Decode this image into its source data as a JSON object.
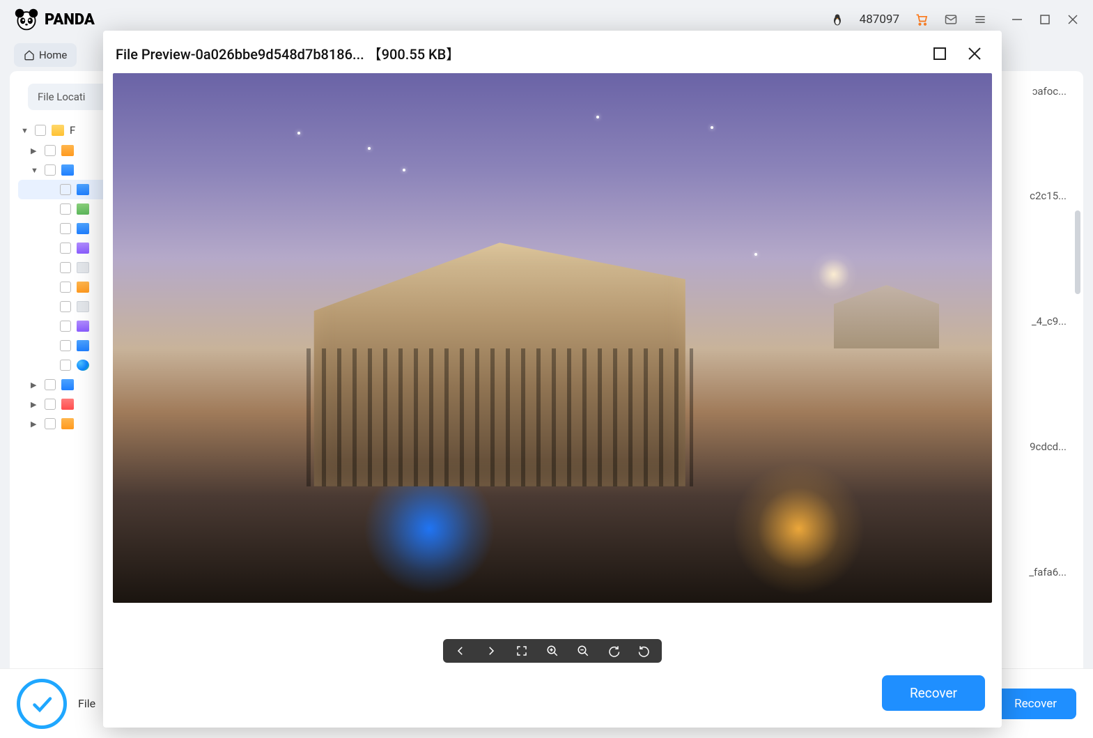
{
  "app": {
    "brand": "PANDA"
  },
  "header": {
    "number": "487097",
    "icons": [
      "penguin-icon",
      "cart-icon",
      "mail-icon",
      "menu-icon"
    ]
  },
  "breadcrumb": {
    "home": "Home"
  },
  "sidebar": {
    "file_location_label": "File Locati",
    "tree": [
      {
        "label": "F",
        "depth": 0,
        "caret": "down",
        "icon": "folder-yellow"
      },
      {
        "label": "",
        "depth": 1,
        "caret": "right",
        "icon": "ic-orange"
      },
      {
        "label": "",
        "depth": 1,
        "caret": "down",
        "icon": "ic-blue"
      },
      {
        "label": "",
        "depth": 2,
        "caret": "",
        "icon": "ic-blue",
        "selected": true
      },
      {
        "label": "",
        "depth": 2,
        "caret": "",
        "icon": "ic-green"
      },
      {
        "label": "",
        "depth": 2,
        "caret": "",
        "icon": "ic-blue"
      },
      {
        "label": "",
        "depth": 2,
        "caret": "",
        "icon": "ic-purple"
      },
      {
        "label": "",
        "depth": 2,
        "caret": "",
        "icon": "ic-gray"
      },
      {
        "label": "",
        "depth": 2,
        "caret": "",
        "icon": "ic-orange"
      },
      {
        "label": "",
        "depth": 2,
        "caret": "",
        "icon": "ic-gray"
      },
      {
        "label": "",
        "depth": 2,
        "caret": "",
        "icon": "ic-purple"
      },
      {
        "label": "",
        "depth": 2,
        "caret": "",
        "icon": "ic-blue"
      },
      {
        "label": "",
        "depth": 2,
        "caret": "",
        "icon": "ic-edge"
      },
      {
        "label": "",
        "depth": 1,
        "caret": "right",
        "icon": "ic-blue"
      },
      {
        "label": "",
        "depth": 1,
        "caret": "right",
        "icon": "ic-red"
      },
      {
        "label": "",
        "depth": 1,
        "caret": "right",
        "icon": "ic-orange"
      }
    ]
  },
  "right_peeks": {
    "p1": "ɔafoc...",
    "p2": "c2c15...",
    "p3": "_4_c9...",
    "p4": "9cdcd...",
    "p5": "_fafa6..."
  },
  "status": {
    "text": "File"
  },
  "footer": {
    "recover": "Recover"
  },
  "modal": {
    "title": "File Preview-0a026bbe9d548d7b8186... 【900.55 KB】",
    "image_alt": "Ancient temple fantasy artwork",
    "recover": "Recover"
  }
}
